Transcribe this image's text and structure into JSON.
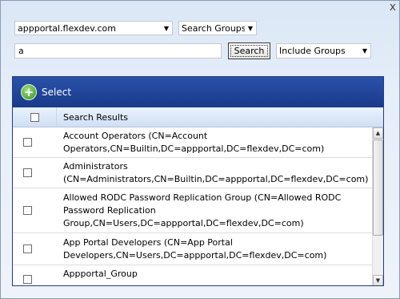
{
  "window": {
    "close_label": "x"
  },
  "filters": {
    "domain": "appportal.flexdev.com",
    "search_scope": "Search Groups",
    "query": "a",
    "search_button": "Search",
    "include": "Include Groups"
  },
  "toolbar": {
    "select_label": "Select"
  },
  "results": {
    "header": "Search Results",
    "rows": [
      {
        "label": "Account Operators (CN=Account\nOperators,CN=Builtin,DC=appportal,DC=flexdev,DC=com)"
      },
      {
        "label": "Administrators\n(CN=Administrators,CN=Builtin,DC=appportal,DC=flexdev,DC=com)"
      },
      {
        "label": "Allowed RODC Password Replication Group (CN=Allowed RODC\nPassword Replication\nGroup,CN=Users,DC=appportal,DC=flexdev,DC=com)"
      },
      {
        "label": "App Portal Developers (CN=App Portal\nDevelopers,CN=Users,DC=appportal,DC=flexdev,DC=com)"
      },
      {
        "label": "Appportal_Group"
      }
    ]
  }
}
